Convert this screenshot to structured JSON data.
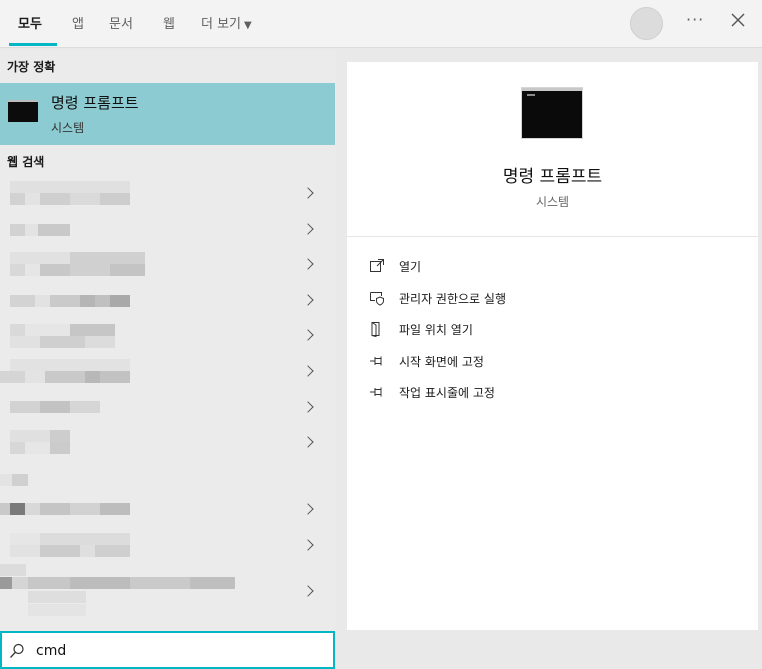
{
  "tabs": [
    {
      "label": "모두",
      "active": true
    },
    {
      "label": "앱"
    },
    {
      "label": "문서"
    },
    {
      "label": "웹"
    },
    {
      "label": "더 보기",
      "has_dropdown": true
    }
  ],
  "header_actions": {
    "more_icon": "ellipsis-icon",
    "close_icon": "close-icon",
    "avatar_icon": "avatar"
  },
  "best_match": {
    "header": "가장 정확",
    "title": "명령 프롬프트",
    "subtitle": "시스템",
    "icon": "command-prompt-icon"
  },
  "web_search": {
    "header": "웹 검색",
    "results": [
      {
        "label": "",
        "blurred": true
      },
      {
        "label": "",
        "blurred": true
      },
      {
        "label": "",
        "blurred": true
      },
      {
        "label": "",
        "blurred": true
      },
      {
        "label": "",
        "blurred": true
      },
      {
        "label": "",
        "blurred": true
      },
      {
        "label": "",
        "blurred": true
      },
      {
        "label": "",
        "blurred": true
      },
      {
        "label": "",
        "blurred": true
      },
      {
        "label": "",
        "blurred": true
      },
      {
        "label": "",
        "blurred": true
      },
      {
        "label": "",
        "blurred": true
      }
    ]
  },
  "detail": {
    "title": "명령 프롬프트",
    "subtitle": "시스템",
    "actions": [
      {
        "label": "열기",
        "icon": "open-icon"
      },
      {
        "label": "관리자 권한으로 실행",
        "icon": "run-as-admin-icon"
      },
      {
        "label": "파일 위치 열기",
        "icon": "file-location-icon"
      },
      {
        "label": "시작 화면에 고정",
        "icon": "pin-start-icon"
      },
      {
        "label": "작업 표시줄에 고정",
        "icon": "pin-taskbar-icon"
      }
    ]
  },
  "search": {
    "value": "cmd",
    "icon": "search-icon"
  },
  "colors": {
    "accent": "#00b7c3",
    "selected": "#8ccbd2",
    "pane": "#ebebeb"
  }
}
